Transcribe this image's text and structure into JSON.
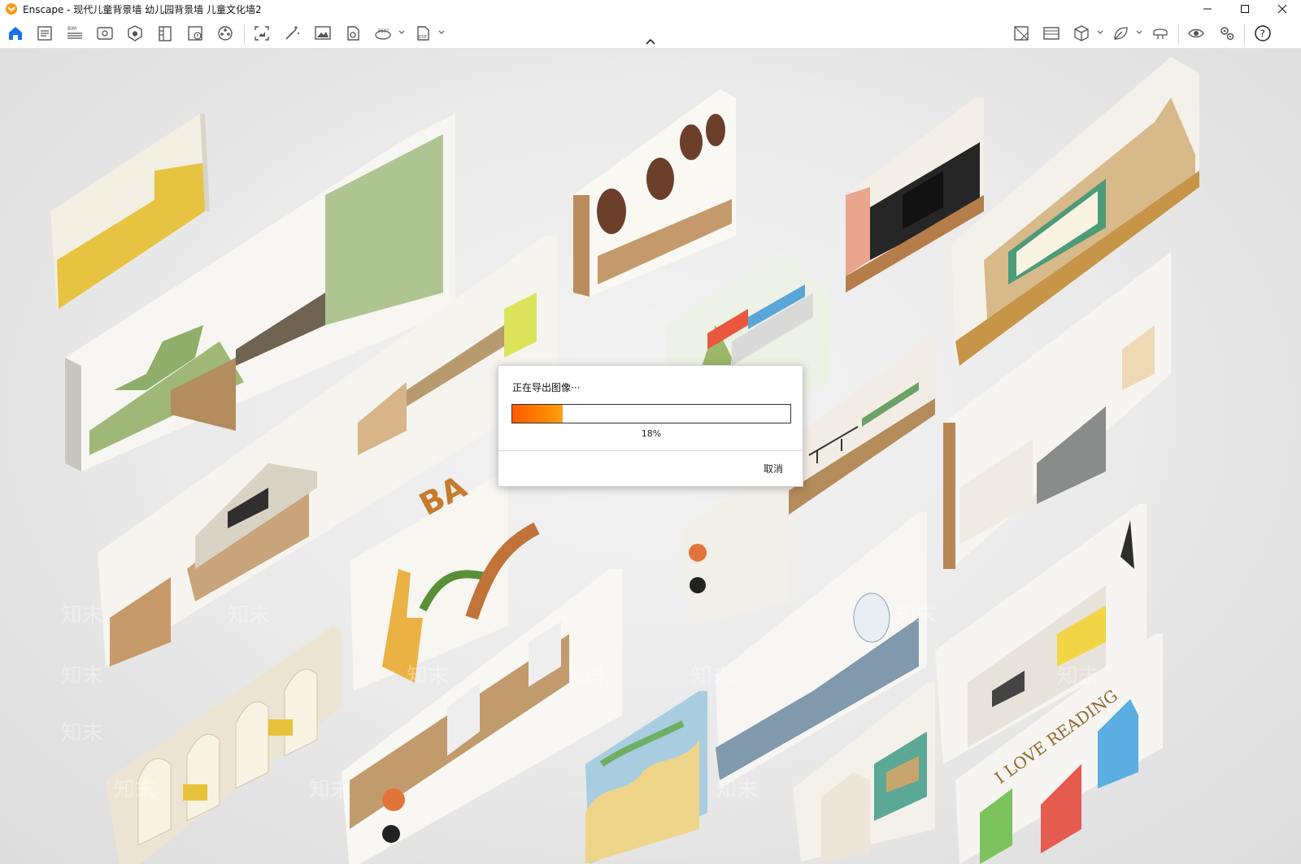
{
  "window": {
    "title": "Enscape - 现代儿童背景墙 幼儿园背景墙 儿童文化墙2",
    "brand_color": "#f39c12"
  },
  "toolbar": {
    "left_icons": [
      "home-icon",
      "notes-icon",
      "bim-icon",
      "views-icon",
      "assets-icon",
      "library-icon",
      "info-icon",
      "video-editor-icon",
      "screenshot-icon",
      "magic-icon",
      "image-export-icon",
      "batch-export-icon",
      "panorama-icon",
      "exe-export-icon"
    ],
    "right_icons": [
      "material-icon",
      "atmosphere-icon",
      "cube-icon",
      "leaf-icon",
      "vr-headset-icon",
      "eye-icon",
      "settings-icon",
      "help-icon"
    ],
    "bim_label": "BIM",
    "pano_label": "360°",
    "exe_label": "EXE",
    "help_label": "?",
    "accent_color": "#1a73e8"
  },
  "dialog": {
    "title": "正在导出图像···",
    "progress_percent": 18,
    "progress_label": "18%",
    "cancel_label": "取消"
  },
  "scene": {
    "banner_text": "BA",
    "wall_text": "I LOVE READING"
  }
}
